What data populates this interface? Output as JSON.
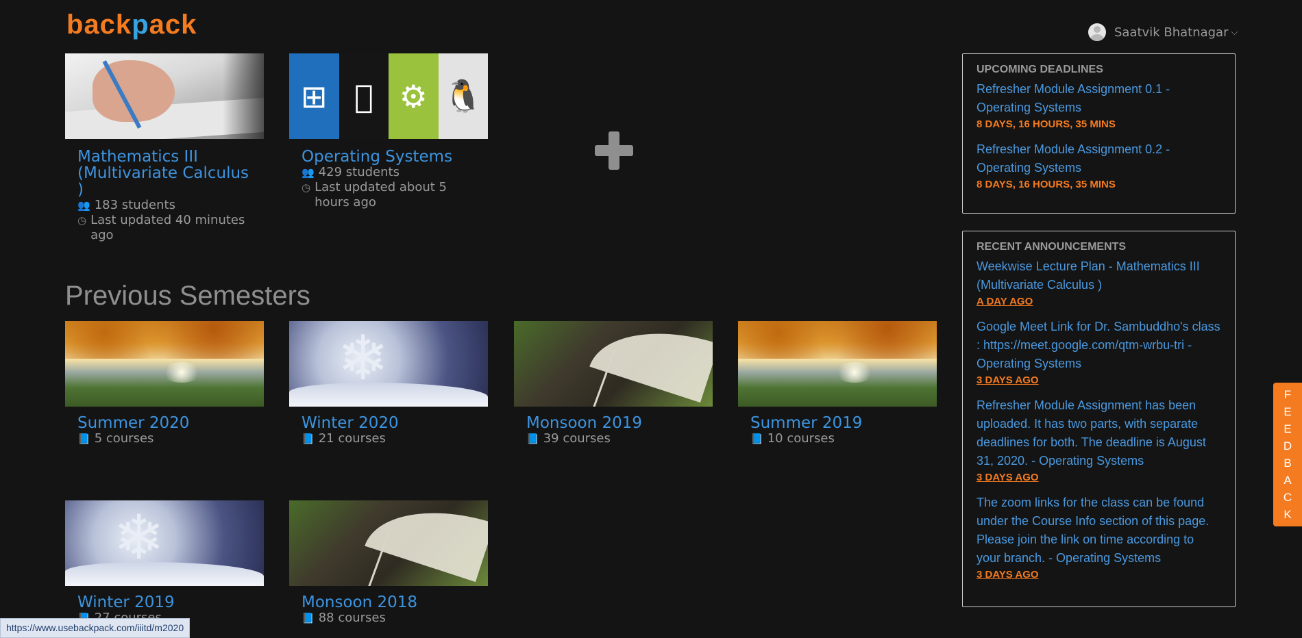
{
  "brand": {
    "logo_b": "b",
    "logo_rest_1": "ack",
    "logo_p": "p",
    "logo_rest_2": "ack"
  },
  "user": {
    "name": "Saatvik Bhatnagar",
    "caret": "⌵"
  },
  "current_courses": [
    {
      "title": "Mathematics III (Multivariate Calculus )",
      "students": "183 students",
      "updated": "Last updated 40 minutes ago"
    },
    {
      "title": "Operating Systems",
      "students": "429 students",
      "updated": "Last updated about 5 hours ago"
    }
  ],
  "add_course_icon": "plus-icon",
  "previous_semesters": {
    "heading": "Previous Semesters",
    "items": [
      {
        "title": "Summer 2020",
        "courses": "5 courses"
      },
      {
        "title": "Winter 2020",
        "courses": "21 courses"
      },
      {
        "title": "Monsoon 2019",
        "courses": "39 courses"
      },
      {
        "title": "Summer 2019",
        "courses": "10 courses"
      },
      {
        "title": "Winter 2019",
        "courses": "27 courses"
      },
      {
        "title": "Monsoon 2018",
        "courses": "88 courses"
      }
    ]
  },
  "deadlines": {
    "heading": "UPCOMING DEADLINES",
    "items": [
      {
        "title": "Refresher Module Assignment 0.1 - Operating Systems",
        "due": "8 DAYS, 16 HOURS, 35 MINS"
      },
      {
        "title": "Refresher Module Assignment 0.2 - Operating Systems",
        "due": "8 DAYS, 16 HOURS, 35 MINS"
      }
    ]
  },
  "announcements": {
    "heading": "RECENT ANNOUNCEMENTS",
    "items": [
      {
        "title": "Weekwise Lecture Plan - Mathematics III (Multivariate Calculus )",
        "ago": "A DAY AGO"
      },
      {
        "title": "Google Meet Link for Dr. Sambuddho's class : https://meet.google.com/qtm-wrbu-tri - Operating Systems",
        "ago": "3 DAYS AGO"
      },
      {
        "title": "Refresher Module Assignment has been uploaded. It has two parts, with separate deadlines for both. The deadline is August 31, 2020. - Operating Systems",
        "ago": "3 DAYS AGO"
      },
      {
        "title": "The zoom links for the class can be found under the Course Info section of this page. Please join the link on time according to your branch. - Operating Systems",
        "ago": "3 DAYS AGO"
      }
    ]
  },
  "feedback_letters": [
    "F",
    "E",
    "E",
    "D",
    "B",
    "A",
    "C",
    "K"
  ],
  "status_url": "https://www.usebackpack.com/iiitd/m2020",
  "colors": {
    "accent_blue": "#3d94e0",
    "accent_orange": "#f47b20",
    "background": "#141414"
  },
  "icons": {
    "students": "users-icon",
    "updated": "clock-icon",
    "courses": "book-icon"
  }
}
